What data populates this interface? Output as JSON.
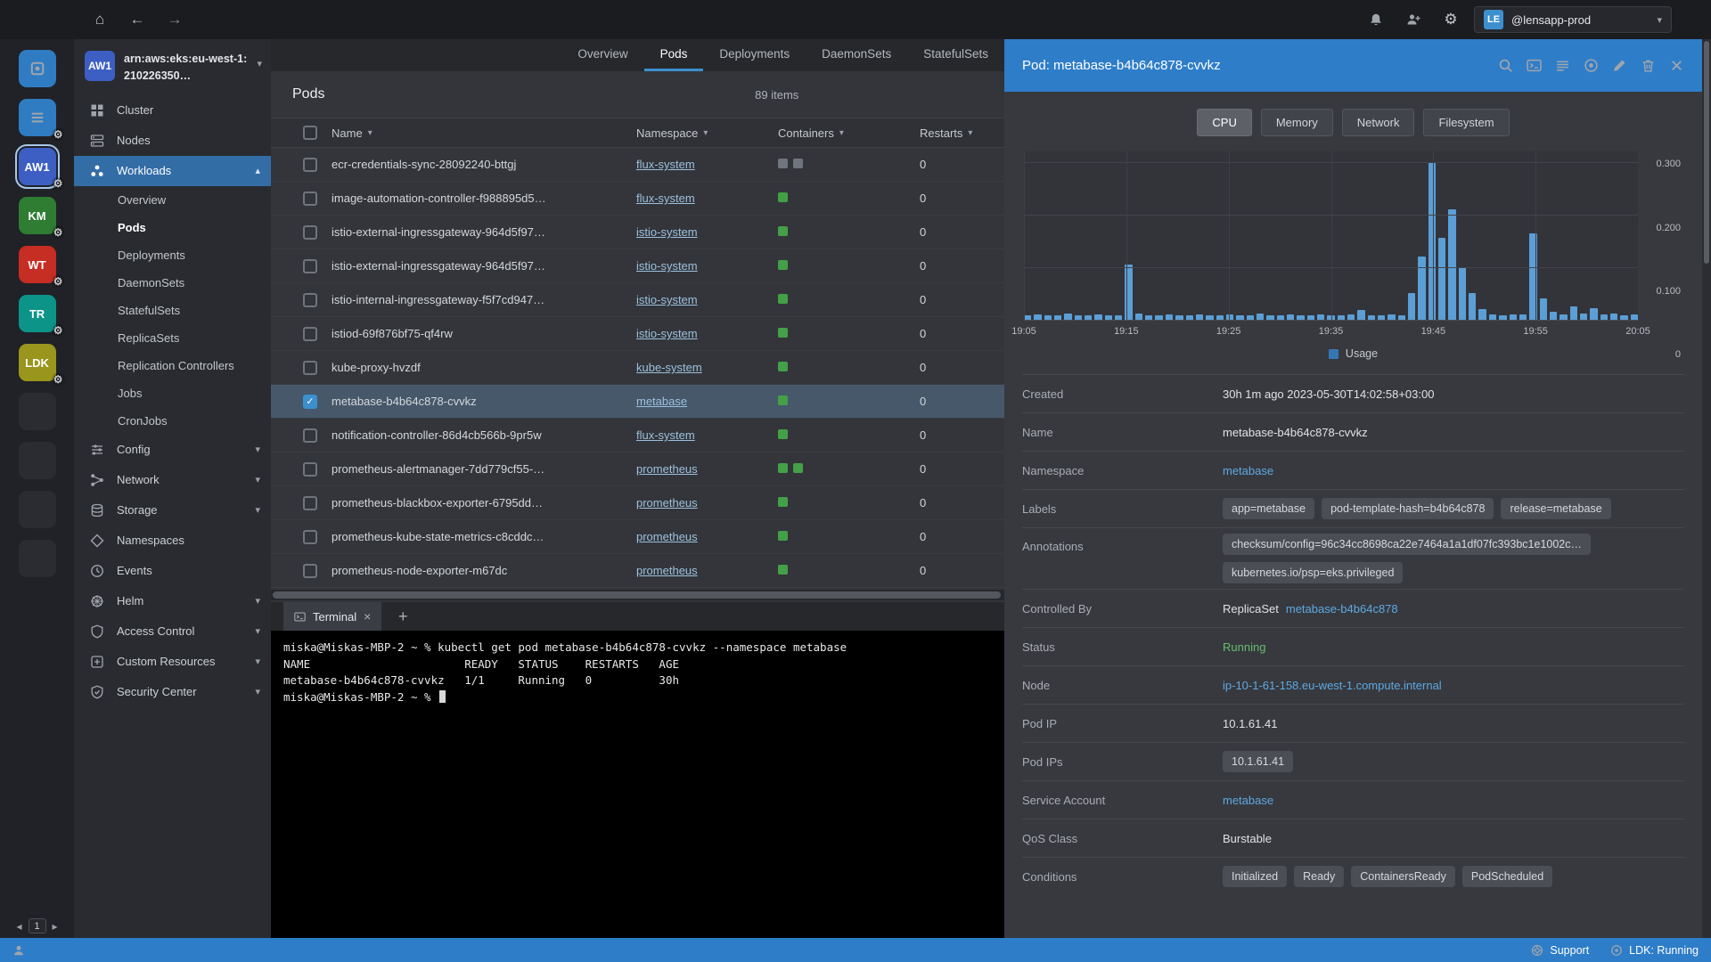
{
  "colors": {
    "accent": "#3d90ce",
    "header_blue": "#2e7dc9",
    "status_green": "#69bb6d"
  },
  "topbar": {
    "account_initials": "LE",
    "account_name": "@lensapp-prod"
  },
  "hotbar": {
    "app_icons": [
      {
        "name": "catalog",
        "icon": "catalog",
        "gear": false
      },
      {
        "name": "hotbar-menu",
        "icon": "list",
        "gear": true
      }
    ],
    "clusters": [
      {
        "label": "AW1",
        "color": "#3d5fc4",
        "selected": true
      },
      {
        "label": "KM",
        "color": "#2e7d32",
        "selected": false
      },
      {
        "label": "WT",
        "color": "#c62d23",
        "selected": false
      },
      {
        "label": "TR",
        "color": "#0d9488",
        "selected": false
      },
      {
        "label": "LDK",
        "color": "#99951d",
        "selected": false
      }
    ],
    "empty_slots": 4,
    "page": "1"
  },
  "sidebar": {
    "cluster_badge": "AW1",
    "cluster_name": "arn:aws:eks:eu-west-1:210226350…",
    "items": [
      {
        "label": "Cluster",
        "icon": "cluster"
      },
      {
        "label": "Nodes",
        "icon": "nodes"
      },
      {
        "label": "Workloads",
        "icon": "workloads",
        "active": true,
        "expanded": true,
        "children": [
          "Overview",
          "Pods",
          "Deployments",
          "DaemonSets",
          "StatefulSets",
          "ReplicaSets",
          "Replication Controllers",
          "Jobs",
          "CronJobs"
        ],
        "active_child": "Pods"
      },
      {
        "label": "Config",
        "icon": "config",
        "collapsible": true
      },
      {
        "label": "Network",
        "icon": "network",
        "collapsible": true
      },
      {
        "label": "Storage",
        "icon": "storage",
        "collapsible": true
      },
      {
        "label": "Namespaces",
        "icon": "namespaces"
      },
      {
        "label": "Events",
        "icon": "events"
      },
      {
        "label": "Helm",
        "icon": "helm",
        "collapsible": true
      },
      {
        "label": "Access Control",
        "icon": "access",
        "collapsible": true
      },
      {
        "label": "Custom Resources",
        "icon": "crd",
        "collapsible": true
      },
      {
        "label": "Security Center",
        "icon": "security",
        "collapsible": true
      }
    ]
  },
  "main": {
    "tabs": [
      "Overview",
      "Pods",
      "Deployments",
      "DaemonSets",
      "StatefulSets"
    ],
    "active_tab": "Pods",
    "title": "Pods",
    "items_count": "89 items",
    "columns": [
      "Name",
      "Namespace",
      "Containers",
      "Restarts"
    ],
    "rows": [
      {
        "name": "ecr-credentials-sync-28092240-bttgj",
        "namespace": "flux-system",
        "containers": [
          "gray",
          "gray"
        ],
        "restarts": "0",
        "selected": false
      },
      {
        "name": "image-automation-controller-f988895d5…",
        "namespace": "flux-system",
        "containers": [
          "green"
        ],
        "restarts": "0",
        "selected": false
      },
      {
        "name": "istio-external-ingressgateway-964d5f97…",
        "namespace": "istio-system",
        "containers": [
          "green"
        ],
        "restarts": "0",
        "selected": false
      },
      {
        "name": "istio-external-ingressgateway-964d5f97…",
        "namespace": "istio-system",
        "containers": [
          "green"
        ],
        "restarts": "0",
        "selected": false
      },
      {
        "name": "istio-internal-ingressgateway-f5f7cd947…",
        "namespace": "istio-system",
        "containers": [
          "green"
        ],
        "restarts": "0",
        "selected": false
      },
      {
        "name": "istiod-69f876bf75-qf4rw",
        "namespace": "istio-system",
        "containers": [
          "green"
        ],
        "restarts": "0",
        "selected": false
      },
      {
        "name": "kube-proxy-hvzdf",
        "namespace": "kube-system",
        "containers": [
          "green"
        ],
        "restarts": "0",
        "selected": false
      },
      {
        "name": "metabase-b4b64c878-cvvkz",
        "namespace": "metabase",
        "containers": [
          "green"
        ],
        "restarts": "0",
        "selected": true
      },
      {
        "name": "notification-controller-86d4cb566b-9pr5w",
        "namespace": "flux-system",
        "containers": [
          "green"
        ],
        "restarts": "0",
        "selected": false
      },
      {
        "name": "prometheus-alertmanager-7dd779cf55-…",
        "namespace": "prometheus",
        "containers": [
          "green",
          "green"
        ],
        "restarts": "0",
        "selected": false
      },
      {
        "name": "prometheus-blackbox-exporter-6795dd…",
        "namespace": "prometheus",
        "containers": [
          "green"
        ],
        "restarts": "0",
        "selected": false
      },
      {
        "name": "prometheus-kube-state-metrics-c8cddc…",
        "namespace": "prometheus",
        "containers": [
          "green"
        ],
        "restarts": "0",
        "selected": false
      },
      {
        "name": "prometheus-node-exporter-m67dc",
        "namespace": "prometheus",
        "containers": [
          "green"
        ],
        "restarts": "0",
        "selected": false
      }
    ]
  },
  "terminal": {
    "tab_label": "Terminal",
    "lines": [
      "miska@Miskas-MBP-2 ~ % kubectl get pod metabase-b4b64c878-cvvkz --namespace metabase",
      "NAME                       READY   STATUS    RESTARTS   AGE",
      "metabase-b4b64c878-cvvkz   1/1     Running   0          30h",
      "miska@Miskas-MBP-2 ~ % "
    ]
  },
  "drawer": {
    "title": "Pod: metabase-b4b64c878-cvvkz",
    "tabs": [
      "CPU",
      "Memory",
      "Network",
      "Filesystem"
    ],
    "active_tab": "CPU",
    "fields": [
      {
        "label": "Created",
        "value": "30h 1m ago 2023-05-30T14:02:58+03:00"
      },
      {
        "label": "Name",
        "value": "metabase-b4b64c878-cvvkz"
      },
      {
        "label": "Namespace",
        "link": "metabase"
      },
      {
        "label": "Labels",
        "badges": [
          "app=metabase",
          "pod-template-hash=b4b64c878",
          "release=metabase"
        ]
      },
      {
        "label": "Annotations",
        "badges": [
          "checksum/config=96c34cc8698ca22e7464a1a1df07fc393bc1e1002c…",
          "kubernetes.io/psp=eks.privileged"
        ],
        "stack": true
      },
      {
        "label": "Controlled By",
        "prefix": "ReplicaSet ",
        "link": "metabase-b4b64c878"
      },
      {
        "label": "Status",
        "value": "Running",
        "color": "green"
      },
      {
        "label": "Node",
        "link": "ip-10-1-61-158.eu-west-1.compute.internal"
      },
      {
        "label": "Pod IP",
        "value": "10.1.61.41"
      },
      {
        "label": "Pod IPs",
        "badges": [
          "10.1.61.41"
        ]
      },
      {
        "label": "Service Account",
        "link": "metabase"
      },
      {
        "label": "QoS Class",
        "value": "Burstable"
      },
      {
        "label": "Conditions",
        "badges": [
          "Initialized",
          "Ready",
          "ContainersReady",
          "PodScheduled"
        ]
      }
    ]
  },
  "chart_data": {
    "type": "bar",
    "title": "Pod CPU usage",
    "x": [
      "19:05",
      "19:15",
      "19:25",
      "19:35",
      "19:45",
      "19:55",
      "20:05"
    ],
    "ylim": [
      0,
      0.32
    ],
    "yticks": [
      "0.300",
      "0.200",
      "0.100",
      "0"
    ],
    "grid": true,
    "legend_position": "bottom",
    "series": [
      {
        "name": "Usage",
        "values": [
          0.008,
          0.01,
          0.009,
          0.008,
          0.012,
          0.009,
          0.008,
          0.01,
          0.009,
          0.008,
          0.105,
          0.012,
          0.009,
          0.008,
          0.01,
          0.009,
          0.008,
          0.011,
          0.009,
          0.008,
          0.01,
          0.009,
          0.008,
          0.012,
          0.009,
          0.008,
          0.01,
          0.009,
          0.008,
          0.01,
          0.009,
          0.008,
          0.011,
          0.018,
          0.009,
          0.008,
          0.01,
          0.009,
          0.05,
          0.12,
          0.3,
          0.155,
          0.21,
          0.1,
          0.05,
          0.02,
          0.01,
          0.009,
          0.01,
          0.011,
          0.165,
          0.04,
          0.015,
          0.01,
          0.025,
          0.012,
          0.022,
          0.01,
          0.012,
          0.009,
          0.01
        ]
      }
    ]
  },
  "statusbar": {
    "support_label": "Support",
    "status_label": "LDK: Running"
  }
}
